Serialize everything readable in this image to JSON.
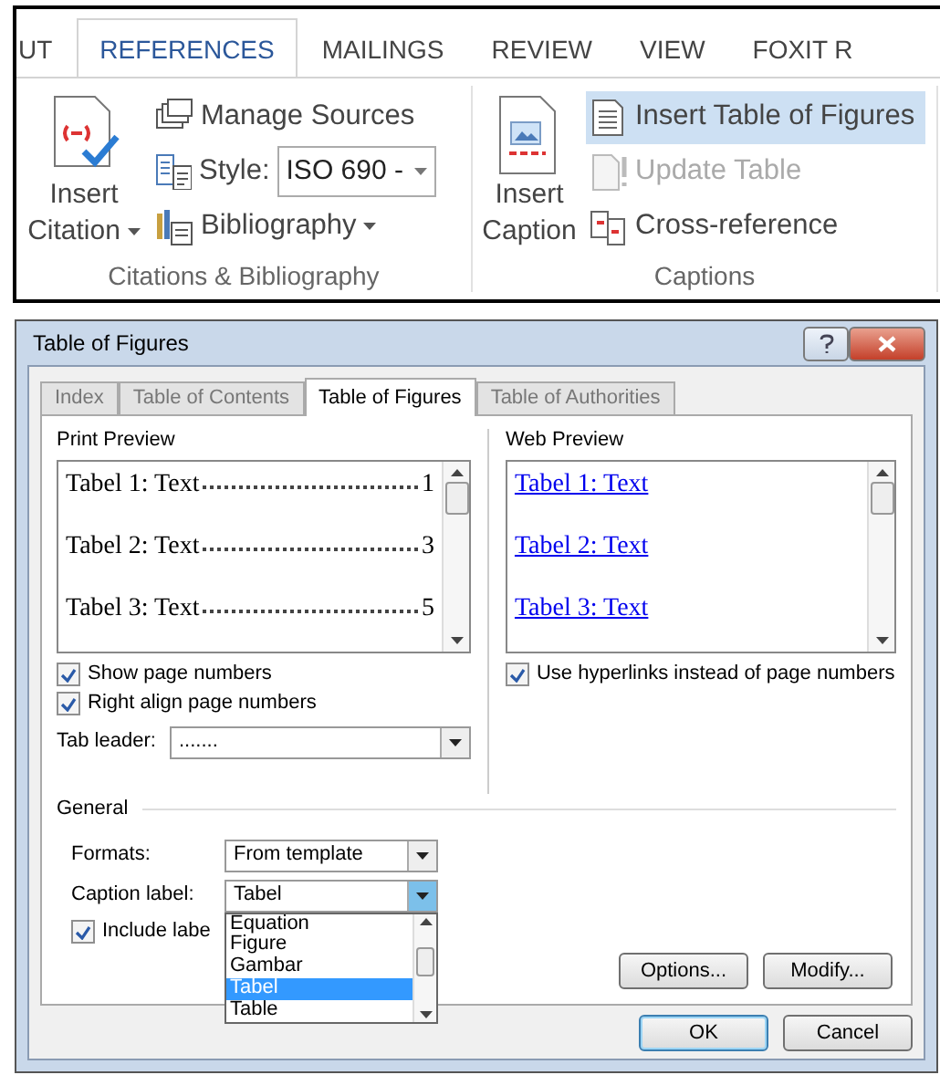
{
  "ribbon": {
    "tabs": [
      {
        "label": "UT",
        "selected": false
      },
      {
        "label": "REFERENCES",
        "selected": true
      },
      {
        "label": "MAILINGS",
        "selected": false
      },
      {
        "label": "REVIEW",
        "selected": false
      },
      {
        "label": "VIEW",
        "selected": false
      },
      {
        "label": "FOXIT R",
        "selected": false
      }
    ],
    "groups": [
      {
        "title": "Citations & Bibliography",
        "large": {
          "lines": [
            "Insert",
            "Citation"
          ],
          "dropdown": true
        },
        "items": [
          {
            "kind": "button",
            "label": "Manage Sources",
            "dropdown": false,
            "highlighted": false,
            "disabled": false
          },
          {
            "kind": "combo",
            "label": "Style:",
            "value": "ISO 690 -"
          },
          {
            "kind": "button",
            "label": "Bibliography",
            "dropdown": true,
            "highlighted": false,
            "disabled": false
          }
        ]
      },
      {
        "title": "Captions",
        "large": {
          "lines": [
            "Insert",
            "Caption"
          ],
          "dropdown": false
        },
        "items": [
          {
            "kind": "button",
            "label": "Insert Table of Figures",
            "dropdown": false,
            "highlighted": true,
            "disabled": false
          },
          {
            "kind": "button",
            "label": "Update Table",
            "dropdown": false,
            "highlighted": false,
            "disabled": true
          },
          {
            "kind": "button",
            "label": "Cross-reference",
            "dropdown": false,
            "highlighted": false,
            "disabled": false
          }
        ]
      }
    ]
  },
  "dialog": {
    "title": "Table of Figures",
    "tabs": [
      {
        "label": "Index",
        "selected": false
      },
      {
        "label": "Table of Contents",
        "selected": false
      },
      {
        "label": "Table of Figures",
        "selected": true
      },
      {
        "label": "Table of Authorities",
        "selected": false
      }
    ],
    "print_preview": {
      "label": "Print Preview",
      "entries": [
        {
          "text": "Tabel 1: Text",
          "page": "1"
        },
        {
          "text": "Tabel 2: Text",
          "page": "3"
        },
        {
          "text": "Tabel 3: Text",
          "page": "5"
        }
      ]
    },
    "show_page_numbers": {
      "label": "Show page numbers",
      "checked": true
    },
    "right_align": {
      "label": "Right align page numbers",
      "checked": true
    },
    "tab_leader": {
      "label": "Tab leader:",
      "value": "......."
    },
    "web_preview": {
      "label": "Web Preview",
      "entries": [
        "Tabel 1: Text",
        "Tabel 2: Text",
        "Tabel 3: Text"
      ]
    },
    "use_hyperlinks": {
      "label": "Use hyperlinks instead of page numbers",
      "checked": true
    },
    "general": {
      "label": "General",
      "formats": {
        "label": "Formats:",
        "value": "From template"
      },
      "caption_label": {
        "label": "Caption label:",
        "value": "Tabel",
        "expanded": true,
        "options": [
          {
            "label": "Equation",
            "selected": false
          },
          {
            "label": "Figure",
            "selected": false
          },
          {
            "label": "Gambar",
            "selected": false
          },
          {
            "label": "Tabel",
            "selected": true
          },
          {
            "label": "Table",
            "selected": false
          }
        ]
      },
      "include_label": {
        "label": "Include labe",
        "checked": true
      },
      "buttons": [
        "Options...",
        "Modify..."
      ]
    },
    "buttons": [
      {
        "label": "OK",
        "default": true
      },
      {
        "label": "Cancel",
        "default": false
      }
    ]
  }
}
